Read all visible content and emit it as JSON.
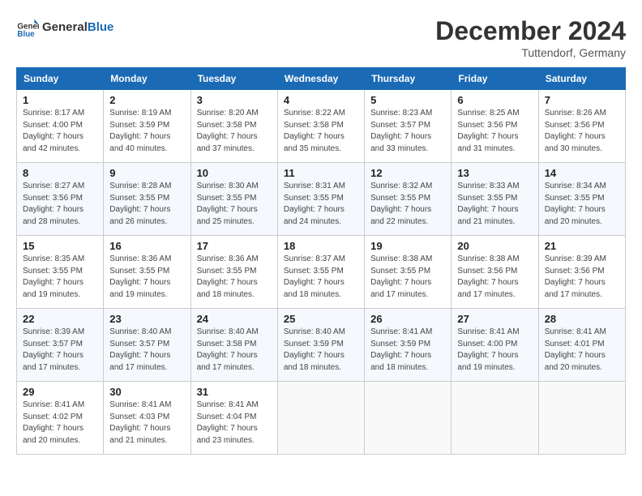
{
  "header": {
    "logo_general": "General",
    "logo_blue": "Blue",
    "month_title": "December 2024",
    "location": "Tuttendorf, Germany"
  },
  "weekdays": [
    "Sunday",
    "Monday",
    "Tuesday",
    "Wednesday",
    "Thursday",
    "Friday",
    "Saturday"
  ],
  "weeks": [
    [
      {
        "day": "1",
        "sunrise": "Sunrise: 8:17 AM",
        "sunset": "Sunset: 4:00 PM",
        "daylight": "Daylight: 7 hours and 42 minutes."
      },
      {
        "day": "2",
        "sunrise": "Sunrise: 8:19 AM",
        "sunset": "Sunset: 3:59 PM",
        "daylight": "Daylight: 7 hours and 40 minutes."
      },
      {
        "day": "3",
        "sunrise": "Sunrise: 8:20 AM",
        "sunset": "Sunset: 3:58 PM",
        "daylight": "Daylight: 7 hours and 37 minutes."
      },
      {
        "day": "4",
        "sunrise": "Sunrise: 8:22 AM",
        "sunset": "Sunset: 3:58 PM",
        "daylight": "Daylight: 7 hours and 35 minutes."
      },
      {
        "day": "5",
        "sunrise": "Sunrise: 8:23 AM",
        "sunset": "Sunset: 3:57 PM",
        "daylight": "Daylight: 7 hours and 33 minutes."
      },
      {
        "day": "6",
        "sunrise": "Sunrise: 8:25 AM",
        "sunset": "Sunset: 3:56 PM",
        "daylight": "Daylight: 7 hours and 31 minutes."
      },
      {
        "day": "7",
        "sunrise": "Sunrise: 8:26 AM",
        "sunset": "Sunset: 3:56 PM",
        "daylight": "Daylight: 7 hours and 30 minutes."
      }
    ],
    [
      {
        "day": "8",
        "sunrise": "Sunrise: 8:27 AM",
        "sunset": "Sunset: 3:56 PM",
        "daylight": "Daylight: 7 hours and 28 minutes."
      },
      {
        "day": "9",
        "sunrise": "Sunrise: 8:28 AM",
        "sunset": "Sunset: 3:55 PM",
        "daylight": "Daylight: 7 hours and 26 minutes."
      },
      {
        "day": "10",
        "sunrise": "Sunrise: 8:30 AM",
        "sunset": "Sunset: 3:55 PM",
        "daylight": "Daylight: 7 hours and 25 minutes."
      },
      {
        "day": "11",
        "sunrise": "Sunrise: 8:31 AM",
        "sunset": "Sunset: 3:55 PM",
        "daylight": "Daylight: 7 hours and 24 minutes."
      },
      {
        "day": "12",
        "sunrise": "Sunrise: 8:32 AM",
        "sunset": "Sunset: 3:55 PM",
        "daylight": "Daylight: 7 hours and 22 minutes."
      },
      {
        "day": "13",
        "sunrise": "Sunrise: 8:33 AM",
        "sunset": "Sunset: 3:55 PM",
        "daylight": "Daylight: 7 hours and 21 minutes."
      },
      {
        "day": "14",
        "sunrise": "Sunrise: 8:34 AM",
        "sunset": "Sunset: 3:55 PM",
        "daylight": "Daylight: 7 hours and 20 minutes."
      }
    ],
    [
      {
        "day": "15",
        "sunrise": "Sunrise: 8:35 AM",
        "sunset": "Sunset: 3:55 PM",
        "daylight": "Daylight: 7 hours and 19 minutes."
      },
      {
        "day": "16",
        "sunrise": "Sunrise: 8:36 AM",
        "sunset": "Sunset: 3:55 PM",
        "daylight": "Daylight: 7 hours and 19 minutes."
      },
      {
        "day": "17",
        "sunrise": "Sunrise: 8:36 AM",
        "sunset": "Sunset: 3:55 PM",
        "daylight": "Daylight: 7 hours and 18 minutes."
      },
      {
        "day": "18",
        "sunrise": "Sunrise: 8:37 AM",
        "sunset": "Sunset: 3:55 PM",
        "daylight": "Daylight: 7 hours and 18 minutes."
      },
      {
        "day": "19",
        "sunrise": "Sunrise: 8:38 AM",
        "sunset": "Sunset: 3:55 PM",
        "daylight": "Daylight: 7 hours and 17 minutes."
      },
      {
        "day": "20",
        "sunrise": "Sunrise: 8:38 AM",
        "sunset": "Sunset: 3:56 PM",
        "daylight": "Daylight: 7 hours and 17 minutes."
      },
      {
        "day": "21",
        "sunrise": "Sunrise: 8:39 AM",
        "sunset": "Sunset: 3:56 PM",
        "daylight": "Daylight: 7 hours and 17 minutes."
      }
    ],
    [
      {
        "day": "22",
        "sunrise": "Sunrise: 8:39 AM",
        "sunset": "Sunset: 3:57 PM",
        "daylight": "Daylight: 7 hours and 17 minutes."
      },
      {
        "day": "23",
        "sunrise": "Sunrise: 8:40 AM",
        "sunset": "Sunset: 3:57 PM",
        "daylight": "Daylight: 7 hours and 17 minutes."
      },
      {
        "day": "24",
        "sunrise": "Sunrise: 8:40 AM",
        "sunset": "Sunset: 3:58 PM",
        "daylight": "Daylight: 7 hours and 17 minutes."
      },
      {
        "day": "25",
        "sunrise": "Sunrise: 8:40 AM",
        "sunset": "Sunset: 3:59 PM",
        "daylight": "Daylight: 7 hours and 18 minutes."
      },
      {
        "day": "26",
        "sunrise": "Sunrise: 8:41 AM",
        "sunset": "Sunset: 3:59 PM",
        "daylight": "Daylight: 7 hours and 18 minutes."
      },
      {
        "day": "27",
        "sunrise": "Sunrise: 8:41 AM",
        "sunset": "Sunset: 4:00 PM",
        "daylight": "Daylight: 7 hours and 19 minutes."
      },
      {
        "day": "28",
        "sunrise": "Sunrise: 8:41 AM",
        "sunset": "Sunset: 4:01 PM",
        "daylight": "Daylight: 7 hours and 20 minutes."
      }
    ],
    [
      {
        "day": "29",
        "sunrise": "Sunrise: 8:41 AM",
        "sunset": "Sunset: 4:02 PM",
        "daylight": "Daylight: 7 hours and 20 minutes."
      },
      {
        "day": "30",
        "sunrise": "Sunrise: 8:41 AM",
        "sunset": "Sunset: 4:03 PM",
        "daylight": "Daylight: 7 hours and 21 minutes."
      },
      {
        "day": "31",
        "sunrise": "Sunrise: 8:41 AM",
        "sunset": "Sunset: 4:04 PM",
        "daylight": "Daylight: 7 hours and 23 minutes."
      },
      null,
      null,
      null,
      null
    ]
  ]
}
